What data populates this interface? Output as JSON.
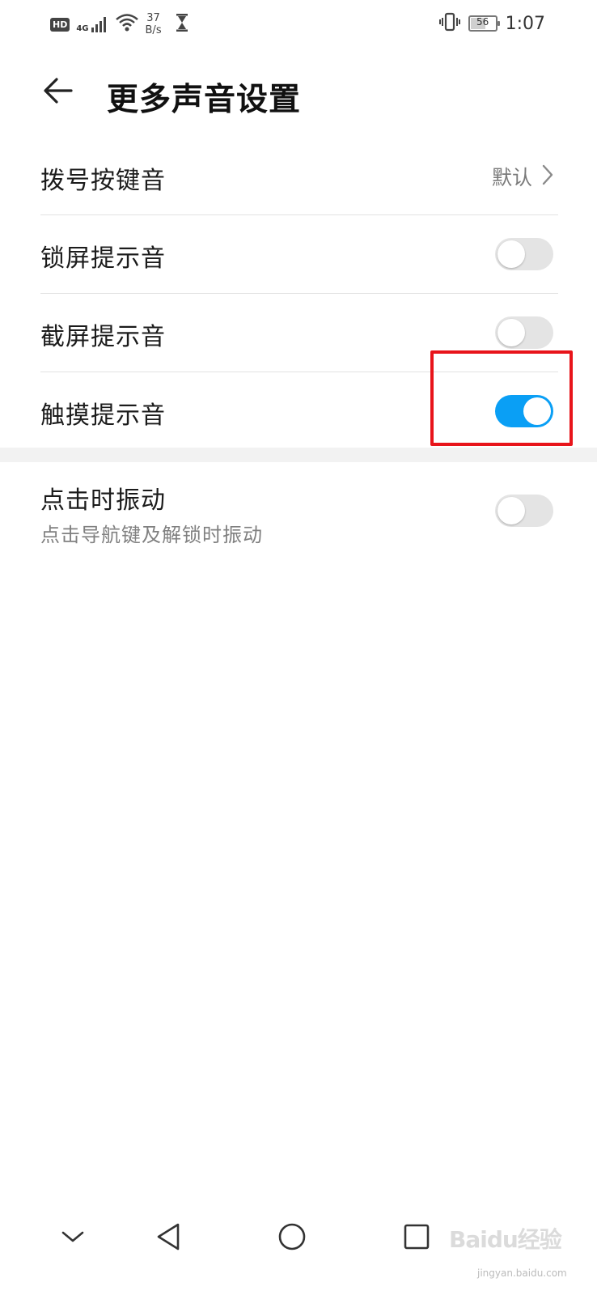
{
  "status_bar": {
    "hd_label": "HD",
    "network_label": "4G",
    "speed_value": "37",
    "speed_unit": "B/s",
    "battery_level": "56",
    "time": "1:07",
    "icons": [
      "signal-icon",
      "wifi-icon",
      "hourglass-icon",
      "vibrate-icon",
      "battery-icon"
    ]
  },
  "header": {
    "title": "更多声音设置",
    "back_icon": "arrow-left-icon"
  },
  "settings": {
    "dial_tone": {
      "label": "拨号按键音",
      "value": "默认"
    },
    "lock_sound": {
      "label": "锁屏提示音",
      "enabled": false
    },
    "screenshot_sound": {
      "label": "截屏提示音",
      "enabled": false
    },
    "touch_sound": {
      "label": "触摸提示音",
      "enabled": true
    },
    "vibrate_on_tap": {
      "label": "点击时振动",
      "description": "点击导航键及解锁时振动",
      "enabled": false
    }
  },
  "colors": {
    "accent": "#0a9ff5",
    "highlight_box": "#e8141a",
    "toggle_off": "#e4e4e4"
  },
  "navigation": {
    "icons": [
      "chevron-down-icon",
      "nav-back-icon",
      "nav-home-icon",
      "nav-recents-icon"
    ]
  },
  "watermark": {
    "brand": "Baidu经验",
    "url": "jingyan.baidu.com"
  }
}
